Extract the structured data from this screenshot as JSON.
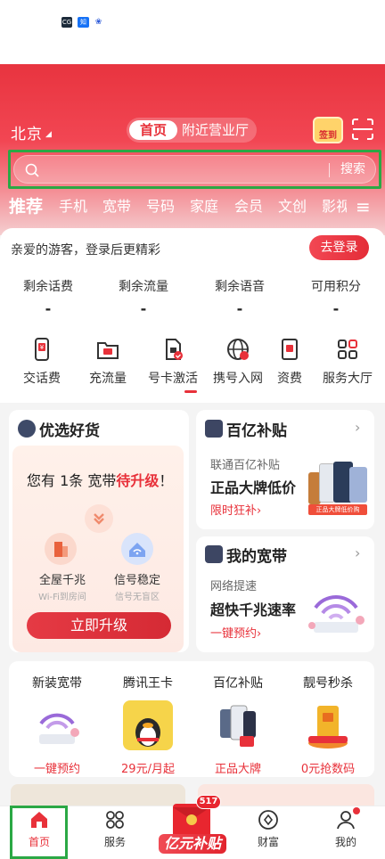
{
  "status_bar": {
    "icons": [
      "CG",
      "知乎",
      "百度"
    ]
  },
  "header": {
    "city": "北京",
    "tabs": [
      {
        "label": "首页",
        "active": true
      },
      {
        "label": "附近营业厅",
        "active": false
      }
    ],
    "sign_in_label": "签到",
    "scan_icon": "scan-icon"
  },
  "search": {
    "placeholder": "",
    "button_label": "搜索"
  },
  "categories": [
    "推荐",
    "手机",
    "宽带",
    "号码",
    "家庭",
    "会员",
    "文创",
    "影视"
  ],
  "menu_icon": "≡",
  "account": {
    "guest_text": "亲爱的游客，登录后更精彩",
    "login_button": "去登录",
    "stats": [
      {
        "label": "剩余话费",
        "value": "-"
      },
      {
        "label": "剩余流量",
        "value": "-"
      },
      {
        "label": "剩余语音",
        "value": "-"
      },
      {
        "label": "可用积分",
        "value": "-"
      }
    ]
  },
  "services": [
    {
      "label": "交话费",
      "icon": "phone-bill-icon"
    },
    {
      "label": "充流量",
      "icon": "data-folder-icon"
    },
    {
      "label": "号卡激活",
      "icon": "sim-activate-icon"
    },
    {
      "label": "携号入网",
      "icon": "globe-icon"
    },
    {
      "label": "资费",
      "icon": "tariff-icon"
    },
    {
      "label": "服务大厅",
      "icon": "service-hall-icon"
    }
  ],
  "youxuan": {
    "title": "优选好货",
    "upgrade_prefix": "您有 1条 宽带",
    "upgrade_highlight": "待升级",
    "upgrade_suffix": "！",
    "features": [
      {
        "title": "全屋千兆",
        "sub": "Wi-Fi到房间"
      },
      {
        "title": "信号稳定",
        "sub": "信号无盲区"
      }
    ],
    "button": "立即升级"
  },
  "subsidy": {
    "title": "百亿补贴",
    "small": "联通百亿补贴",
    "big": "正品大牌低价",
    "link": "限时狂补",
    "badge": "正品大牌低价购"
  },
  "broadband": {
    "title": "我的宽带",
    "small": "网络提速",
    "big": "超快千兆速率",
    "link": "一键预约"
  },
  "promos": [
    {
      "title": "新装宽带",
      "sub": "一键预约"
    },
    {
      "title": "腾讯王卡",
      "sub": "29元/月起"
    },
    {
      "title": "百亿补贴",
      "sub": "正品大牌"
    },
    {
      "title": "靓号秒杀",
      "sub": "0元抢数码"
    }
  ],
  "tabbar": {
    "items": [
      {
        "label": "首页",
        "active": true
      },
      {
        "label": "服务",
        "active": false
      },
      {
        "label": "财富",
        "active": false
      },
      {
        "label": "我的",
        "active": false
      }
    ],
    "center_label": "亿元补贴",
    "center_badge": "517"
  },
  "colors": {
    "brand_red": "#e8313a",
    "highlight_green": "#2ba845"
  }
}
